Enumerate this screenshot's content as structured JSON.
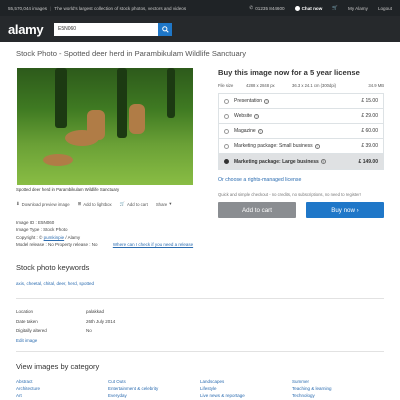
{
  "topbar": {
    "count": "55,570,044 images",
    "tagline": "The world's largest collection of stock photos, vectors and videos",
    "phone": "01235 844600",
    "chat": "Chat now",
    "my_alamy": "My Alamy",
    "logout": "Logout"
  },
  "header": {
    "logo": "alamy",
    "search_value": "E5N060"
  },
  "page": {
    "title": "Stock Photo - Spotted deer herd in Parambikulam Wildlife Sanctuary"
  },
  "photo": {
    "caption": "Spotted deer herd in Parambikulam Wildlife Sanctuary",
    "actions": {
      "download": "Download preview image",
      "lightbox": "Add to lightbox",
      "cart": "Add to cart",
      "share": "Share"
    }
  },
  "meta": {
    "image_id": "Image ID : E5N060",
    "image_type": "Image Type : Stock Photo",
    "copyright_prefix": "Copyright : ",
    "copyright_link": "pumkinpie",
    "copyright_suffix": " / Alamy",
    "releases": "Model release : No   Property release : No",
    "releases_link": "Where can I check if you need a release"
  },
  "license": {
    "title": "Buy this image now for a 5 year license",
    "file_size_label": "File size",
    "pixels": "4288 x 2848 px",
    "dimensions": "36.3 x 24.1 cm (300dpi)",
    "mb": "34.9 MB",
    "options": [
      {
        "label": "Presentation",
        "price": "£ 15.00",
        "selected": false
      },
      {
        "label": "Website",
        "price": "£ 29.00",
        "selected": false
      },
      {
        "label": "Magazine",
        "price": "£ 60.00",
        "selected": false
      },
      {
        "label": "Marketing package: Small business",
        "price": "£ 39.00",
        "selected": false
      },
      {
        "label": "Marketing package: Large business",
        "price": "£ 149.00",
        "selected": true
      }
    ],
    "rm_link": "Or choose a rights-managed license",
    "quick_note": "Quick and simple checkout - no credits, no subscriptions, no need to register!",
    "add_to_cart": "Add to cart",
    "buy_now": "Buy now ›"
  },
  "keywords": {
    "title": "Stock photo keywords",
    "list": "axis, cheetal, chital, deer, herd, spotted"
  },
  "details": {
    "rows": [
      {
        "label": "Location",
        "value": "palakkad"
      },
      {
        "label": "Date taken",
        "value": "26th July 2014"
      },
      {
        "label": "Digitally altered",
        "value": "No"
      }
    ],
    "edit": "Edit image"
  },
  "categories": {
    "title": "View images by category",
    "items": [
      "Abstract",
      "Cut Outs",
      "Landscapes",
      "Summer",
      "Architecture",
      "Entertainment & celebrity",
      "Lifestyle",
      "Teaching & learning",
      "Art",
      "Everyday",
      "Live news & reportage",
      "Technology"
    ]
  }
}
